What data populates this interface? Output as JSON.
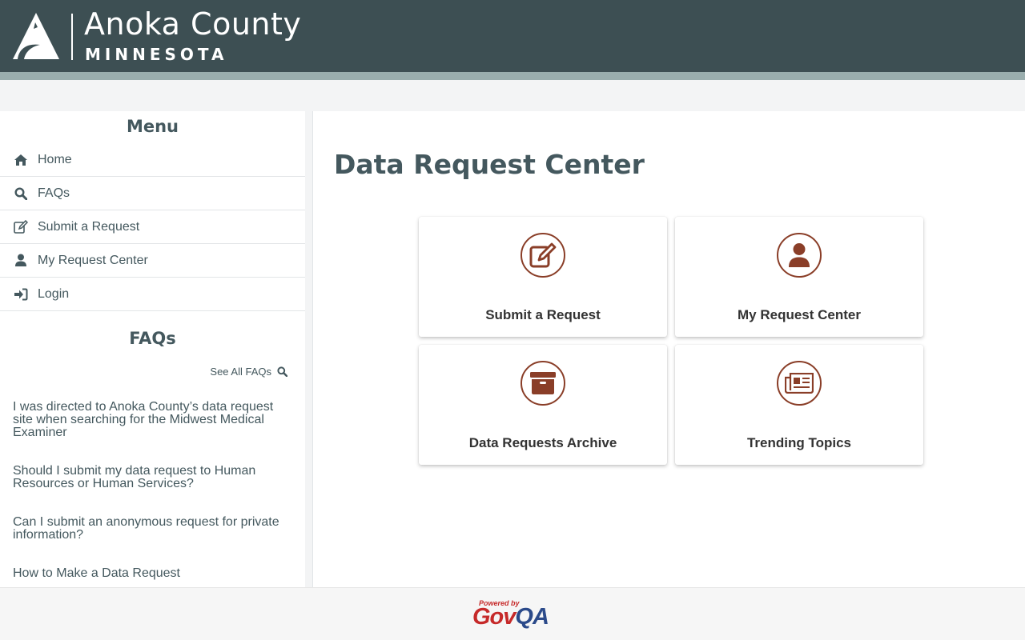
{
  "header": {
    "title": "Anoka County",
    "subtitle": "MINNESOTA",
    "logo_icon": "mountain-logo-icon"
  },
  "sidebar": {
    "menu_heading": "Menu",
    "items": [
      {
        "label": "Home",
        "icon": "home-icon"
      },
      {
        "label": "FAQs",
        "icon": "search-icon"
      },
      {
        "label": "Submit a Request",
        "icon": "edit-icon"
      },
      {
        "label": "My Request Center",
        "icon": "user-icon"
      },
      {
        "label": "Login",
        "icon": "sign-in-icon"
      }
    ],
    "faq_heading": "FAQs",
    "see_all_label": "See All FAQs",
    "faqs": [
      "I was directed to Anoka County’s data request site when searching for the Midwest Medical Examiner",
      "Should I submit my data request to Human Resources or Human Services?",
      "Can I submit an anonymous request for private information?",
      "How to Make a Data Request"
    ]
  },
  "main": {
    "title": "Data Request Center",
    "cards": [
      {
        "label": "Submit a Request",
        "icon": "edit-icon"
      },
      {
        "label": "My Request Center",
        "icon": "user-icon"
      },
      {
        "label": "Data Requests Archive",
        "icon": "archive-icon"
      },
      {
        "label": "Trending Topics",
        "icon": "newspaper-icon"
      }
    ]
  },
  "footer": {
    "powered_by": "Powered by",
    "brand_gov": "Gov",
    "brand_qa": "QA"
  },
  "colors": {
    "header_bg": "#3d4f53",
    "accent": "#8a3e28",
    "text": "#44585e",
    "brand_red": "#c62a2a",
    "brand_blue": "#2b4a8a"
  }
}
